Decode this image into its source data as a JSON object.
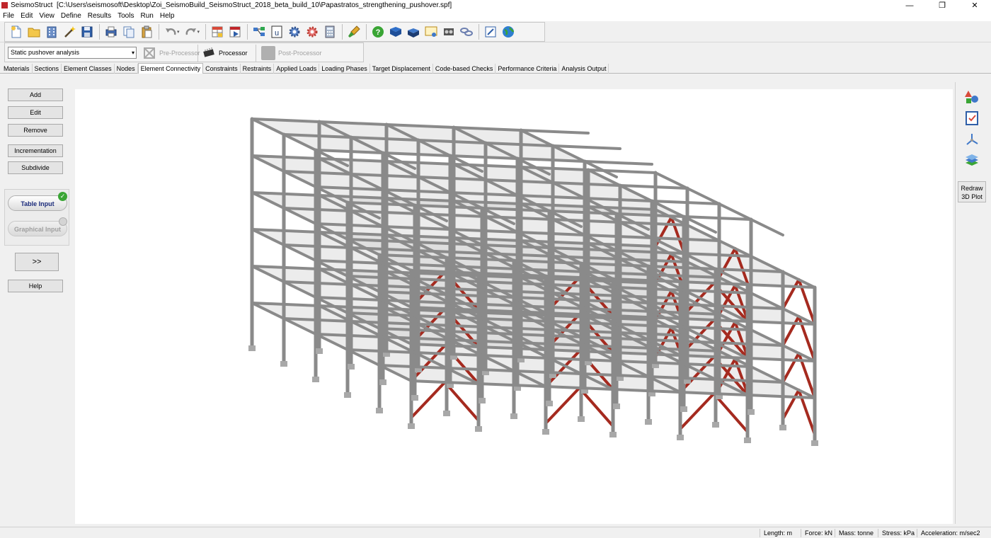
{
  "window": {
    "app_name": "SeismoStruct",
    "file_path": "[C:\\Users\\seismosoft\\Desktop\\Zoi_SeismoBuild_SeismoStruct_2018_beta_build_10\\Papastratos_strengthening_pushover.spf]",
    "minimize": "—",
    "restore": "❐",
    "close": "✕"
  },
  "menu": [
    "File",
    "Edit",
    "View",
    "Define",
    "Results",
    "Tools",
    "Run",
    "Help"
  ],
  "toolbar": {
    "icons": [
      "new-file-icon",
      "open-folder-icon",
      "building-icon",
      "wizard-icon",
      "save-icon",
      "print-icon",
      "copy-icon",
      "paste-icon",
      "undo-icon",
      "redo-icon",
      "table-icon",
      "run-icon",
      "network-icon",
      "u-icon",
      "gear-icon",
      "settings-icon",
      "calculator-icon",
      "brush-icon",
      "help-icon",
      "book-icon",
      "books-icon",
      "certificate-icon",
      "film-icon",
      "links-icon",
      "edit-icon",
      "globe-icon"
    ]
  },
  "modes": {
    "analysis_type": "Static pushover analysis",
    "pre_processor": "Pre-Processor",
    "processor": "Processor",
    "post_processor": "Post-Processor"
  },
  "tabs": [
    "Materials",
    "Sections",
    "Element Classes",
    "Nodes",
    "Element Connectivity",
    "Constraints",
    "Restraints",
    "Applied Loads",
    "Loading Phases",
    "Target Displacement",
    "Code-based Checks",
    "Performance Criteria",
    "Analysis Output"
  ],
  "active_tab": "Element Connectivity",
  "left_panel": {
    "add": "Add",
    "edit": "Edit",
    "remove": "Remove",
    "incrementation": "Incrementation",
    "subdivide": "Subdivide",
    "table_input": "Table Input",
    "graphical_input": "Graphical Input",
    "expand": ">>",
    "help": "Help"
  },
  "right_panel": {
    "redraw_line1": "Redraw",
    "redraw_line2": "3D Plot"
  },
  "status": {
    "length": "Length: m",
    "force": "Force: kN",
    "mass": "Mass: tonne",
    "stress": "Stress: kPa",
    "acceleration": "Acceleration: m/sec2"
  },
  "colors": {
    "brace_red": "#a52a1f",
    "frame_grey": "#8a8a8a",
    "slab_grey": "#c9c9c9",
    "active_pill_text": "#1a2a7a",
    "check_green": "#3aa535"
  }
}
